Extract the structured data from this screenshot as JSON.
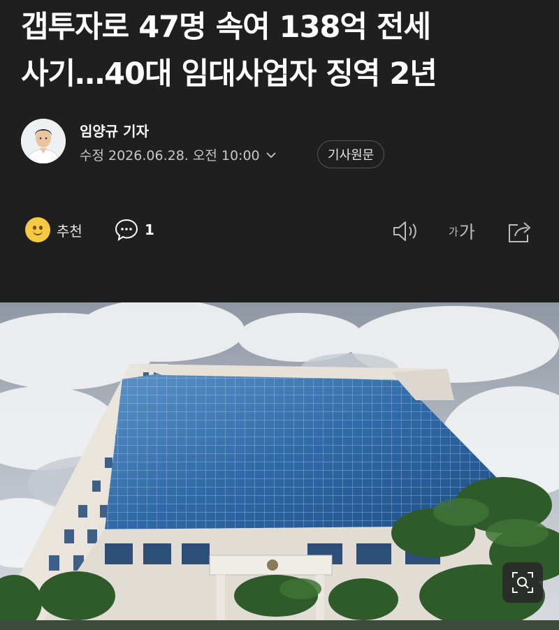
{
  "article": {
    "title_line1": "갭투자로 47명 속여 138억 전세",
    "title_line2": "사기…40대 임대사업자 징역 2년"
  },
  "byline": {
    "author": "임양규 기자",
    "modified": "수정 2026.06.28. 오전 10:00",
    "original_button": "기사원문"
  },
  "actions": {
    "recommend_label": "추천",
    "comment_count": "1",
    "font_small": "가",
    "font_big": "가"
  },
  "icons": {
    "recommend": "smiley-icon",
    "comment": "speech-bubble-icon",
    "tts": "speaker-icon",
    "font": "font-size-icon",
    "share": "share-icon",
    "zoom": "zoom-icon"
  },
  "colors": {
    "background": "#1f1f1f",
    "text": "#ffffff",
    "muted": "#c8c8c8",
    "emoji": "#f6c944"
  }
}
